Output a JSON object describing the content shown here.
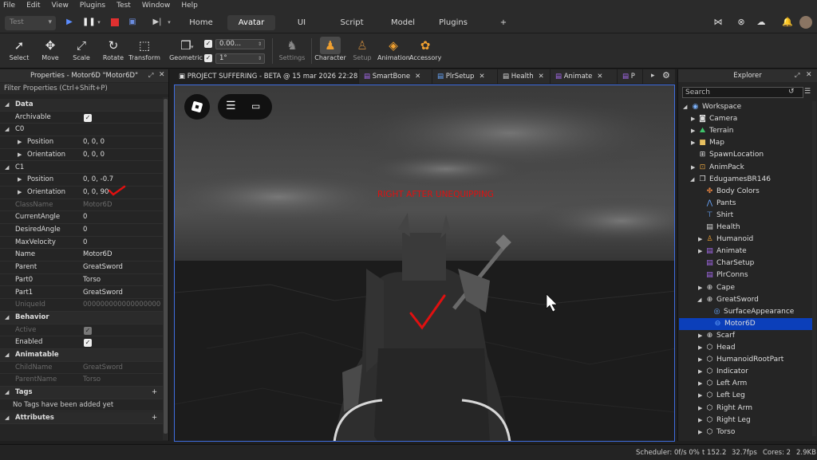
{
  "menu": [
    "File",
    "Edit",
    "View",
    "Plugins",
    "Test",
    "Window",
    "Help"
  ],
  "topbar": {
    "mode_select": "Test",
    "tabs": [
      {
        "label": "Home",
        "active": false
      },
      {
        "label": "Avatar",
        "active": true
      },
      {
        "label": "UI",
        "active": false
      },
      {
        "label": "Script",
        "active": false
      },
      {
        "label": "Model",
        "active": false
      },
      {
        "label": "Plugins",
        "active": false
      }
    ],
    "add_tab": "+"
  },
  "ribbon": {
    "tools": [
      "Select",
      "Move",
      "Scale",
      "Rotate",
      "Transform",
      "Geometric"
    ],
    "move_step": "0.00...",
    "rotate_step": "1°",
    "settings": "Settings",
    "avatar_tools": [
      "Character",
      "Setup",
      "Animation",
      "Accessory"
    ]
  },
  "properties": {
    "title": "Properties - Motor6D \"Motor6D\"",
    "filter": "Filter Properties (Ctrl+Shift+P)",
    "rows": [
      {
        "type": "section",
        "label": "Data"
      },
      {
        "type": "check",
        "label": "Archivable",
        "checked": true
      },
      {
        "type": "sub",
        "label": "C0"
      },
      {
        "type": "child",
        "label": "Position",
        "value": "0, 0, 0"
      },
      {
        "type": "child",
        "label": "Orientation",
        "value": "0, 0, 0"
      },
      {
        "type": "sub",
        "label": "C1"
      },
      {
        "type": "child",
        "label": "Position",
        "value": "0, 0, -0.7"
      },
      {
        "type": "child",
        "label": "Orientation",
        "value": "0, 0, 90"
      },
      {
        "type": "dim",
        "label": "ClassName",
        "value": "Motor6D"
      },
      {
        "type": "plain",
        "label": "CurrentAngle",
        "value": "0"
      },
      {
        "type": "plain",
        "label": "DesiredAngle",
        "value": "0"
      },
      {
        "type": "plain",
        "label": "MaxVelocity",
        "value": "0"
      },
      {
        "type": "plain",
        "label": "Name",
        "value": "Motor6D"
      },
      {
        "type": "plain",
        "label": "Parent",
        "value": "GreatSword"
      },
      {
        "type": "plain",
        "label": "Part0",
        "value": "Torso"
      },
      {
        "type": "plain",
        "label": "Part1",
        "value": "GreatSword"
      },
      {
        "type": "dim",
        "label": "UniqueId",
        "value": "000000000000000000000"
      },
      {
        "type": "section",
        "label": "Behavior"
      },
      {
        "type": "dimcheck",
        "label": "Active",
        "checked": true
      },
      {
        "type": "check",
        "label": "Enabled",
        "checked": true
      },
      {
        "type": "section",
        "label": "Animatable"
      },
      {
        "type": "dim",
        "label": "ChildName",
        "value": "GreatSword"
      },
      {
        "type": "dim",
        "label": "ParentName",
        "value": "Torso"
      },
      {
        "type": "section",
        "label": "Tags"
      },
      {
        "type": "note",
        "label": "No Tags have been added yet"
      },
      {
        "type": "section",
        "label": "Attributes"
      }
    ]
  },
  "doc_tabs": [
    {
      "label": "PROJECT SUFFERING - BETA @ 15 mar 2026 22:28",
      "icon": "roblox"
    },
    {
      "label": "SmartBone",
      "icon": "script"
    },
    {
      "label": "PlrSetup",
      "icon": "script"
    },
    {
      "label": "Health",
      "icon": "doc"
    },
    {
      "label": "Animate",
      "icon": "script"
    },
    {
      "label": "P",
      "icon": "script"
    }
  ],
  "viewport": {
    "annotation": "RIGHT AFTER UNEQUIPPING",
    "annotation_color": "#e01010"
  },
  "explorer": {
    "title": "Explorer",
    "search_placeholder": "Search",
    "items": [
      {
        "label": "Workspace",
        "depth": 0,
        "exp": "open",
        "icon": "workspace"
      },
      {
        "label": "Camera",
        "depth": 1,
        "exp": "closed",
        "icon": "camera"
      },
      {
        "label": "Terrain",
        "depth": 1,
        "exp": "closed",
        "icon": "terrain"
      },
      {
        "label": "Map",
        "depth": 1,
        "exp": "closed",
        "icon": "folder"
      },
      {
        "label": "SpawnLocation",
        "depth": 1,
        "exp": "none",
        "icon": "spawn"
      },
      {
        "label": "AnimPack",
        "depth": 1,
        "exp": "closed",
        "icon": "anim"
      },
      {
        "label": "EdugamesBR146",
        "depth": 1,
        "exp": "open",
        "icon": "model"
      },
      {
        "label": "Body Colors",
        "depth": 2,
        "exp": "none",
        "icon": "bodycolors"
      },
      {
        "label": "Pants",
        "depth": 2,
        "exp": "none",
        "icon": "pants"
      },
      {
        "label": "Shirt",
        "depth": 2,
        "exp": "none",
        "icon": "shirt"
      },
      {
        "label": "Health",
        "depth": 2,
        "exp": "none",
        "icon": "doc"
      },
      {
        "label": "Humanoid",
        "depth": 2,
        "exp": "closed",
        "icon": "humanoid"
      },
      {
        "label": "Animate",
        "depth": 2,
        "exp": "closed",
        "icon": "script"
      },
      {
        "label": "CharSetup",
        "depth": 2,
        "exp": "none",
        "icon": "script"
      },
      {
        "label": "PlrConns",
        "depth": 2,
        "exp": "none",
        "icon": "script"
      },
      {
        "label": "Cape",
        "depth": 2,
        "exp": "closed",
        "icon": "part"
      },
      {
        "label": "GreatSword",
        "depth": 2,
        "exp": "open",
        "icon": "part"
      },
      {
        "label": "SurfaceAppearance",
        "depth": 3,
        "exp": "none",
        "icon": "surface"
      },
      {
        "label": "Motor6D",
        "depth": 3,
        "exp": "none",
        "icon": "motor",
        "selected": true
      },
      {
        "label": "Scarf",
        "depth": 2,
        "exp": "closed",
        "icon": "part"
      },
      {
        "label": "Head",
        "depth": 2,
        "exp": "closed",
        "icon": "cube"
      },
      {
        "label": "HumanoidRootPart",
        "depth": 2,
        "exp": "closed",
        "icon": "cube"
      },
      {
        "label": "Indicator",
        "depth": 2,
        "exp": "closed",
        "icon": "cube"
      },
      {
        "label": "Left Arm",
        "depth": 2,
        "exp": "closed",
        "icon": "cube"
      },
      {
        "label": "Left Leg",
        "depth": 2,
        "exp": "closed",
        "icon": "cube"
      },
      {
        "label": "Right Arm",
        "depth": 2,
        "exp": "closed",
        "icon": "cube"
      },
      {
        "label": "Right Leg",
        "depth": 2,
        "exp": "closed",
        "icon": "cube"
      },
      {
        "label": "Torso",
        "depth": 2,
        "exp": "closed",
        "icon": "cube"
      }
    ]
  },
  "status": {
    "scheduler": "Scheduler: 0f/s 0%",
    "t": "t 152.2",
    "fps": "32.7fps",
    "cores": "Cores: 2",
    "size": "2.9KB"
  },
  "colors": {
    "accent": "#3f6de0",
    "selection": "#0b3fba",
    "annotation": "#e01010"
  }
}
